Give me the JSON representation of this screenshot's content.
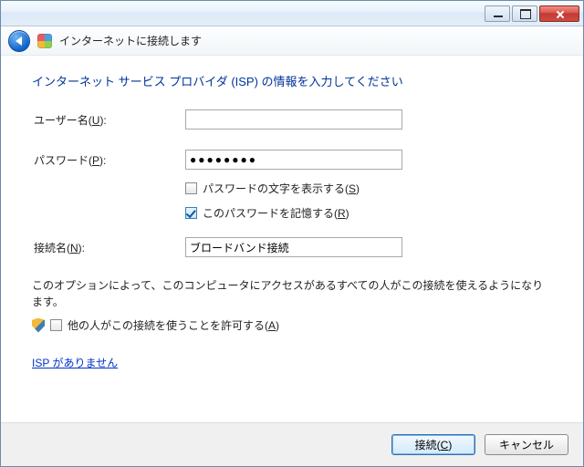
{
  "titlebar": {
    "min_tip": "最小化",
    "max_tip": "最大化",
    "close_tip": "閉じる"
  },
  "nav": {
    "title": "インターネットに接続します"
  },
  "heading": "インターネット サービス プロバイダ (ISP) の情報を入力してください",
  "form": {
    "username_label": "ユーザー名(",
    "username_key": "U",
    "username_label_tail": "):",
    "password_label": "パスワード(",
    "password_key": "P",
    "password_label_tail": "):",
    "password_value": "●●●●●●●●",
    "show_pw_label": "パスワードの文字を表示する(",
    "show_pw_key": "S",
    "show_pw_tail": ")",
    "remember_pw_label": "このパスワードを記憶する(",
    "remember_pw_key": "R",
    "remember_pw_tail": ")",
    "connection_label": "接続名(",
    "connection_key": "N",
    "connection_label_tail": "):",
    "connection_value": "ブロードバンド接続"
  },
  "option_desc": "このオプションによって、このコンピュータにアクセスがあるすべての人がこの接続を使えるようになります。",
  "allow_label": "他の人がこの接続を使うことを許可する(",
  "allow_key": "A",
  "allow_tail": ")",
  "link_no_isp": "ISP がありません",
  "footer": {
    "connect": "接続(",
    "connect_key": "C",
    "connect_tail": ")",
    "cancel": "キャンセル"
  }
}
